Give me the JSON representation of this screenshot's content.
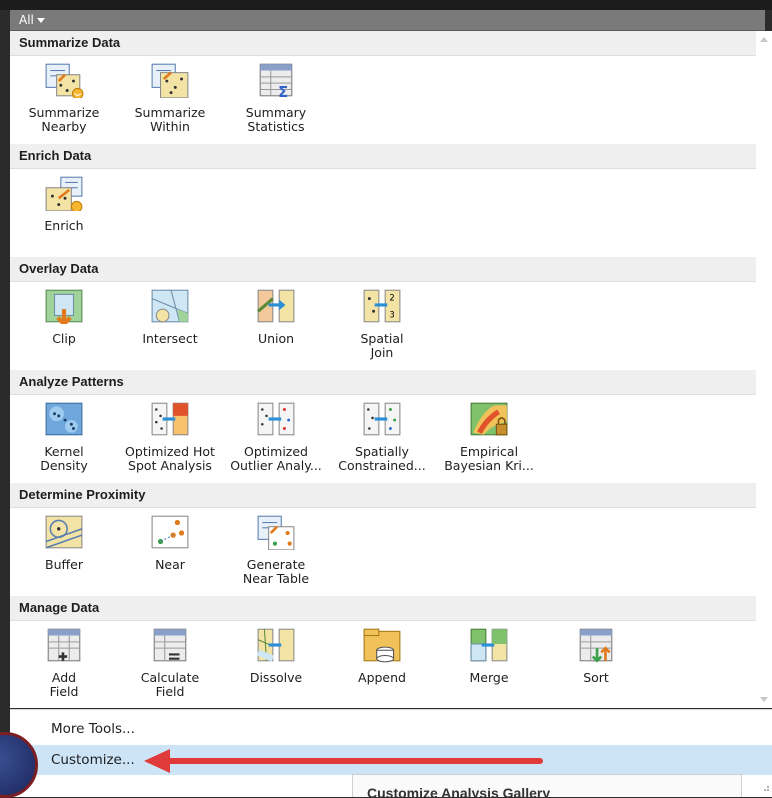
{
  "filter": {
    "label": "All"
  },
  "sections": [
    {
      "title": "Summarize Data",
      "tools": [
        {
          "label": "Summarize\nNearby",
          "icon": "summarize-nearby-icon"
        },
        {
          "label": "Summarize\nWithin",
          "icon": "summarize-within-icon"
        },
        {
          "label": "Summary\nStatistics",
          "icon": "summary-statistics-icon"
        }
      ]
    },
    {
      "title": "Enrich Data",
      "tools": [
        {
          "label": "Enrich",
          "icon": "enrich-icon"
        }
      ]
    },
    {
      "title": "Overlay Data",
      "tools": [
        {
          "label": "Clip",
          "icon": "clip-icon"
        },
        {
          "label": "Intersect",
          "icon": "intersect-icon"
        },
        {
          "label": "Union",
          "icon": "union-icon"
        },
        {
          "label": "Spatial\nJoin",
          "icon": "spatial-join-icon"
        }
      ]
    },
    {
      "title": "Analyze Patterns",
      "tools": [
        {
          "label": "Kernel\nDensity",
          "icon": "kernel-density-icon"
        },
        {
          "label": "Optimized Hot\nSpot Analysis",
          "icon": "hot-spot-icon"
        },
        {
          "label": "Optimized\nOutlier Analy...",
          "icon": "outlier-icon"
        },
        {
          "label": "Spatially\nConstrained...",
          "icon": "spatially-constrained-icon"
        },
        {
          "label": "Empirical\nBayesian Kri...",
          "icon": "bayesian-kriging-icon"
        }
      ]
    },
    {
      "title": "Determine Proximity",
      "tools": [
        {
          "label": "Buffer",
          "icon": "buffer-icon"
        },
        {
          "label": "Near",
          "icon": "near-icon"
        },
        {
          "label": "Generate\nNear Table",
          "icon": "near-table-icon"
        }
      ]
    },
    {
      "title": "Manage Data",
      "tools": [
        {
          "label": "Add\nField",
          "icon": "add-field-icon"
        },
        {
          "label": "Calculate\nField",
          "icon": "calculate-field-icon"
        },
        {
          "label": "Dissolve",
          "icon": "dissolve-icon"
        },
        {
          "label": "Append",
          "icon": "append-icon"
        },
        {
          "label": "Merge",
          "icon": "merge-icon"
        },
        {
          "label": "Sort",
          "icon": "sort-icon"
        }
      ]
    }
  ],
  "menu": {
    "more_tools": "More Tools...",
    "customize": "Customize..."
  },
  "tooltip": {
    "title": "Customize Analysis Gallery"
  },
  "colors": {
    "highlight": "#cde4f7",
    "arrow": "#e03a3a",
    "section_bg": "#efefef"
  }
}
